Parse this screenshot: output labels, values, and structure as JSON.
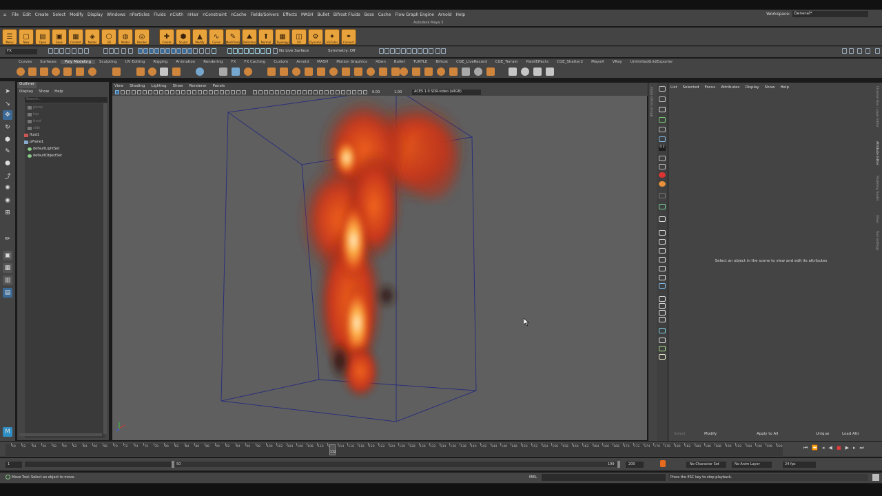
{
  "menubar": {
    "items": [
      "File",
      "Edit",
      "Create",
      "Select",
      "Modify",
      "Display",
      "Windows",
      "nParticles",
      "Fluids",
      "nCloth",
      "nHair",
      "nConstraint",
      "nCache",
      "Fields/Solvers",
      "Effects",
      "MASH",
      "Bullet",
      "Bifrost Fluids",
      "Boss",
      "Cache",
      "Flow Graph Engine",
      "Arnold",
      "Help"
    ],
    "workspace_label": "Workspace:",
    "workspace_value": "General*"
  },
  "app_title": "Autodesk Maya 3",
  "big_shelf": [
    "Menu",
    "New",
    "Open",
    "Save",
    "Content",
    "Nodes",
    "3D",
    "Model",
    "Render",
    "Create",
    "Sculpt",
    "Modify",
    "Curve",
    "MeshTools",
    "Deformer",
    "Normal",
    "Topology",
    "UV",
    "Dynamic",
    "VisColor",
    "Connect"
  ],
  "status_line": {
    "mode": "FX",
    "live_surface": "No Live Surface",
    "symmetry": "Symmetry: Off"
  },
  "shelf_tabs": [
    "Curves",
    "Surfaces",
    "Poly Modeling",
    "Sculpting",
    "UV Editing",
    "Rigging",
    "Animation",
    "Rendering",
    "FX",
    "FX Caching",
    "Custom",
    "Arnold",
    "MASH",
    "Motion Graphics",
    "XGen",
    "Bullet",
    "TURTLE",
    "Bifrost",
    "CGE_LiveRecord",
    "CGE_Terrain",
    "PaintEffects",
    "CGE_Shatter2",
    "MayaX",
    "VRay",
    "UnlimitedGridExporter"
  ],
  "shelf_active": "Poly Modeling",
  "outliner": {
    "tab": "Outliner",
    "menu": [
      "Display",
      "Show",
      "Help"
    ],
    "search_placeholder": "Search...",
    "items": [
      {
        "name": "persp",
        "dim": true
      },
      {
        "name": "top",
        "dim": true
      },
      {
        "name": "front",
        "dim": true
      },
      {
        "name": "side",
        "dim": true
      },
      {
        "name": "fluid1",
        "dim": false
      },
      {
        "name": "pPlane1",
        "dim": false
      },
      {
        "name": "defaultLightSet",
        "dim": false
      },
      {
        "name": "defaultObjectSet",
        "dim": false
      }
    ]
  },
  "viewport": {
    "menu": [
      "View",
      "Shading",
      "Lighting",
      "Show",
      "Renderer",
      "Panels"
    ],
    "exposure": "0.00",
    "gamma": "1.00",
    "colorspace": "ACES 1.0 SDR-video (sRGB)"
  },
  "vertical_strip_label": "Bifrost Graph Editor",
  "attribute_editor": {
    "menu": [
      "List",
      "Selected",
      "Focus",
      "Attributes",
      "Display",
      "Show",
      "Help"
    ],
    "message": "Select an object in the scene to view and edit its attributes",
    "buttons": {
      "select": "Select",
      "modify": "Modify",
      "apply_all": "Apply to All",
      "unique": "Unique",
      "load_attr": "Load Attr"
    },
    "side_tabs": [
      "Channel Box / Layer Editor",
      "Attribute Editor",
      "Modeling Toolkit",
      "XGen",
      "Tool Settings"
    ],
    "tool_value": "0.2"
  },
  "time_slider": {
    "ticks": [
      "50",
      "52",
      "54",
      "56",
      "58",
      "60",
      "62",
      "64",
      "66",
      "68",
      "70",
      "72",
      "74",
      "76",
      "78",
      "80",
      "82",
      "84",
      "86",
      "88",
      "90",
      "92",
      "94",
      "96",
      "98",
      "100",
      "102",
      "104",
      "106",
      "108",
      "110",
      "112",
      "114",
      "116",
      "118",
      "120",
      "122",
      "124",
      "126",
      "128",
      "130",
      "132",
      "134",
      "136",
      "138",
      "140",
      "142",
      "144",
      "146",
      "148",
      "150",
      "152",
      "154",
      "156",
      "158",
      "160",
      "162",
      "164",
      "166",
      "168",
      "170",
      "172",
      "174",
      "176",
      "178",
      "180",
      "182",
      "184",
      "186",
      "188",
      "190",
      "192",
      "194",
      "196",
      "198",
      "200"
    ],
    "current_frame": "112"
  },
  "range": {
    "start": "1",
    "range_start": "50",
    "range_end": "199",
    "end": "200",
    "character_set": "No Character Set",
    "anim_layer": "No Anim Layer",
    "fps": "24 fps"
  },
  "help_line": {
    "text": "Move Tool: Select an object to move.",
    "mel": "MEL",
    "feedback": "Press the ESC key to stop playback."
  }
}
